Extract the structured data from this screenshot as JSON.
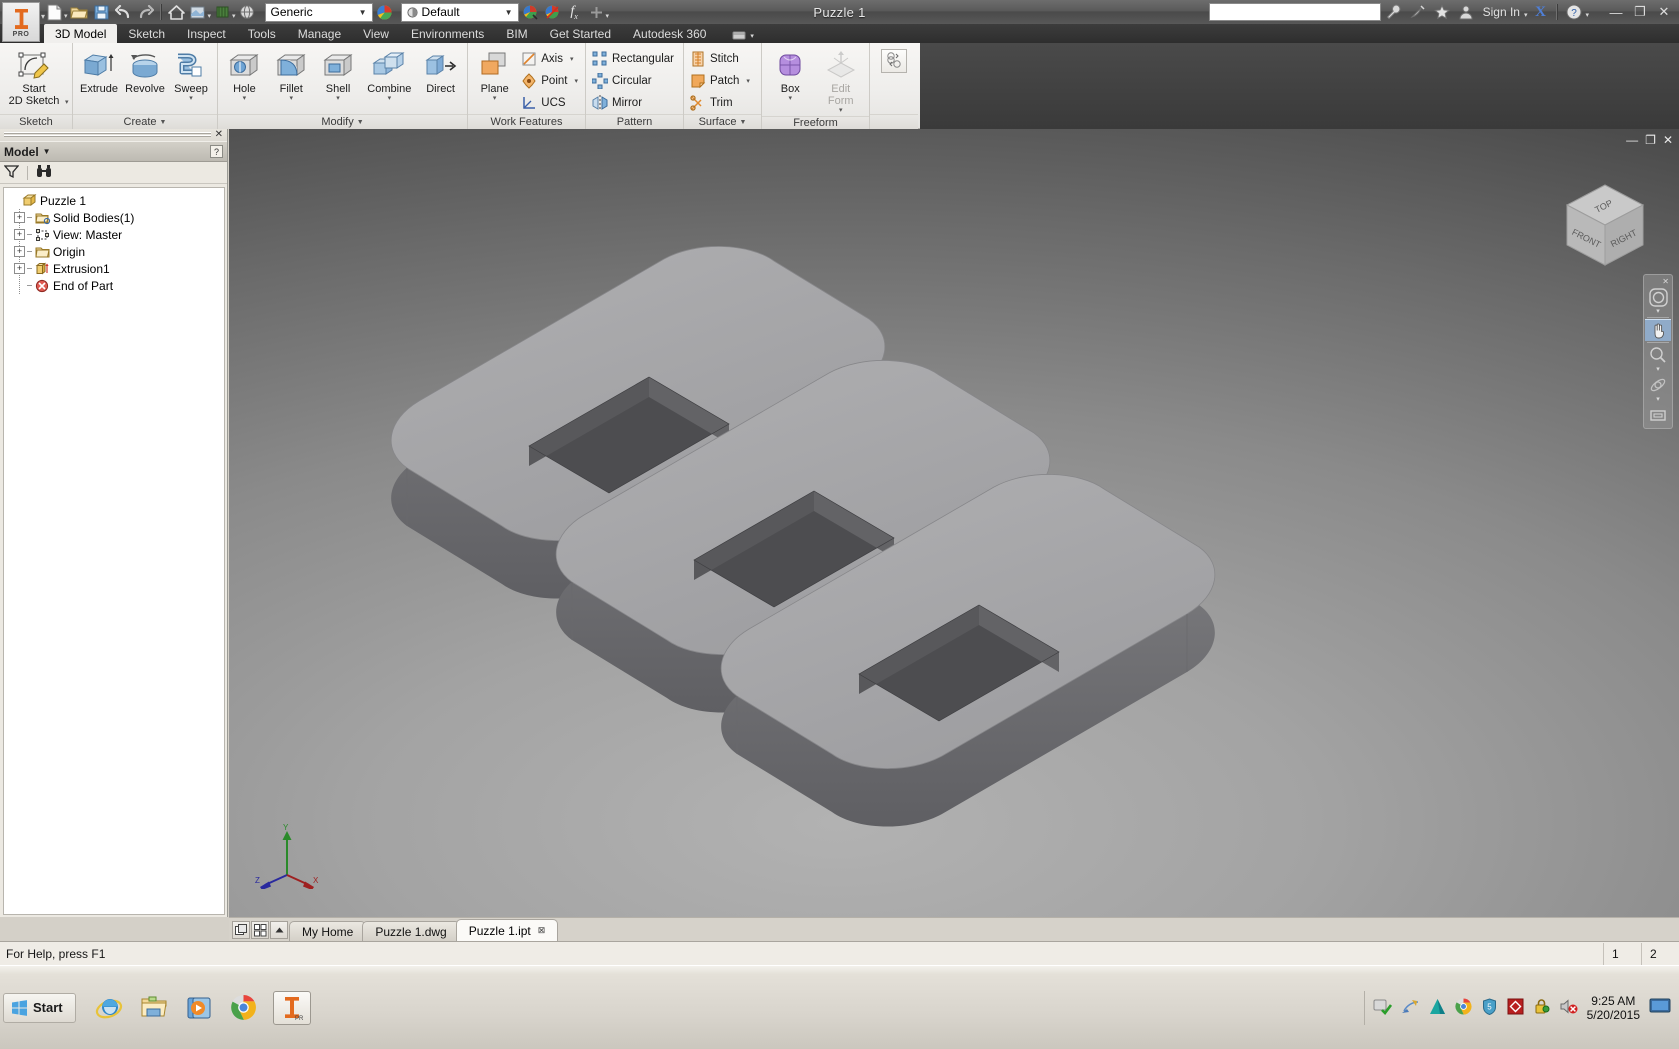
{
  "titlebar": {
    "document_title": "Puzzle 1",
    "material_combo": "Generic",
    "appearance_combo": "Default",
    "search_placeholder": "",
    "search_value": "",
    "signin_label": "Sign In",
    "qat": [
      {
        "name": "new-file",
        "icon": "new-document-icon"
      },
      {
        "name": "open-file",
        "icon": "open-folder-icon"
      },
      {
        "name": "save-file",
        "icon": "save-disk-icon"
      },
      {
        "name": "undo",
        "icon": "undo-arrow-icon"
      },
      {
        "name": "redo",
        "icon": "redo-arrow-icon"
      },
      {
        "name": "home-view",
        "icon": "home-icon"
      },
      {
        "name": "display-style",
        "icon": "shaded-display-icon"
      },
      {
        "name": "appearance-override",
        "icon": "appearance-icon"
      },
      {
        "name": "orbit-view",
        "icon": "orbit-globe-icon"
      }
    ],
    "right_icons": [
      {
        "name": "search-help",
        "icon": "wrench-icon"
      },
      {
        "name": "satellite",
        "icon": "satellite-dish-icon"
      },
      {
        "name": "favorites",
        "icon": "star-icon"
      },
      {
        "name": "account",
        "icon": "person-icon"
      }
    ],
    "exchange_label": "X",
    "help_label": "?",
    "window_buttons": {
      "minimize": "—",
      "restore": "❐",
      "close": "✕"
    }
  },
  "app_button": {
    "label": "PRO"
  },
  "ribbon_tabs": [
    {
      "label": "3D Model",
      "active": true
    },
    {
      "label": "Sketch",
      "active": false
    },
    {
      "label": "Inspect",
      "active": false
    },
    {
      "label": "Tools",
      "active": false
    },
    {
      "label": "Manage",
      "active": false
    },
    {
      "label": "View",
      "active": false
    },
    {
      "label": "Environments",
      "active": false
    },
    {
      "label": "BIM",
      "active": false
    },
    {
      "label": "Get Started",
      "active": false
    },
    {
      "label": "Autodesk 360",
      "active": false
    }
  ],
  "ribbon_panels": [
    {
      "name": "sketch",
      "label": "Sketch",
      "buttons": [
        {
          "label": "Start",
          "label2": "2D Sketch",
          "icon": "start-2d-sketch-icon",
          "dropdown": true
        }
      ]
    },
    {
      "name": "create",
      "label": "Create",
      "has_dialog_launcher": true,
      "buttons": [
        {
          "label": "Extrude",
          "icon": "extrude-icon",
          "dropdown": false
        },
        {
          "label": "Revolve",
          "icon": "revolve-icon",
          "dropdown": false
        },
        {
          "label": "Sweep",
          "icon": "sweep-icon",
          "dropdown": true
        }
      ]
    },
    {
      "name": "modify",
      "label": "Modify",
      "has_dialog_launcher": true,
      "buttons": [
        {
          "label": "Hole",
          "icon": "hole-icon",
          "dropdown": true
        },
        {
          "label": "Fillet",
          "icon": "fillet-icon",
          "dropdown": true
        },
        {
          "label": "Shell",
          "icon": "shell-icon",
          "dropdown": true
        },
        {
          "label": "Combine",
          "icon": "combine-icon",
          "dropdown": true
        },
        {
          "label": "Direct",
          "icon": "direct-edit-icon",
          "dropdown": false
        }
      ]
    },
    {
      "name": "work-features",
      "label": "Work Features",
      "big_buttons": [
        {
          "label": "Plane",
          "icon": "work-plane-icon",
          "dropdown": true
        }
      ],
      "small_buttons": [
        {
          "label": "Axis",
          "icon": "work-axis-icon",
          "dropdown": true
        },
        {
          "label": "Point",
          "icon": "work-point-icon",
          "dropdown": true
        },
        {
          "label": "UCS",
          "icon": "ucs-icon",
          "dropdown": false
        }
      ]
    },
    {
      "name": "pattern",
      "label": "Pattern",
      "small_buttons": [
        {
          "label": "Rectangular",
          "icon": "rectangular-pattern-icon",
          "dropdown": false
        },
        {
          "label": "Circular",
          "icon": "circular-pattern-icon",
          "dropdown": false
        },
        {
          "label": "Mirror",
          "icon": "mirror-icon",
          "dropdown": false
        }
      ]
    },
    {
      "name": "surface",
      "label": "Surface",
      "has_dialog_launcher": true,
      "small_buttons": [
        {
          "label": "Stitch",
          "icon": "stitch-icon",
          "dropdown": false
        },
        {
          "label": "Patch",
          "icon": "patch-icon",
          "dropdown": true
        },
        {
          "label": "Trim",
          "icon": "trim-scissors-icon",
          "dropdown": false
        }
      ]
    },
    {
      "name": "freeform",
      "label": "Freeform",
      "buttons": [
        {
          "label": "Box",
          "icon": "freeform-box-icon",
          "dropdown": true,
          "disabled": false
        },
        {
          "label": "Edit",
          "label2": "Form",
          "icon": "edit-form-icon",
          "dropdown": true,
          "disabled": true
        }
      ]
    },
    {
      "name": "convert",
      "label": "",
      "buttons": [
        {
          "label": "",
          "icon": "convert-icon",
          "dropdown": false
        }
      ]
    }
  ],
  "browser": {
    "panel_title": "Model",
    "help_glyph": "?",
    "tools": [
      {
        "name": "filter-icon",
        "glyph": "filter"
      },
      {
        "name": "find-binoculars-icon",
        "glyph": "binoculars"
      }
    ],
    "tree": [
      {
        "label": "Puzzle 1",
        "icon": "part-document-icon",
        "level": 0,
        "expander": ""
      },
      {
        "label": "Solid Bodies(1)",
        "icon": "solid-bodies-folder-icon",
        "level": 1,
        "expander": "+"
      },
      {
        "label": "View: Master",
        "icon": "view-master-icon",
        "level": 1,
        "expander": "+"
      },
      {
        "label": "Origin",
        "icon": "origin-folder-icon",
        "level": 1,
        "expander": "+"
      },
      {
        "label": "Extrusion1",
        "icon": "extrusion-feature-icon",
        "level": 1,
        "expander": "+"
      },
      {
        "label": "End of Part",
        "icon": "end-of-part-icon",
        "level": 1,
        "expander": ""
      }
    ]
  },
  "viewport": {
    "window_buttons": {
      "minimize": "—",
      "restore": "❐",
      "close": "✕"
    },
    "viewcube": {
      "top_face": "TOP",
      "front_face": "FRONT",
      "right_face": "RIGHT"
    },
    "navbar": {
      "close_glyph": "✕",
      "items": [
        {
          "name": "steering-wheel-icon",
          "selected": false,
          "caret": true
        },
        {
          "name": "pan-hand-icon",
          "selected": true,
          "caret": false
        },
        {
          "name": "zoom-magnifier-icon",
          "selected": false,
          "caret": true
        },
        {
          "name": "orbit-icon",
          "selected": false,
          "caret": true
        },
        {
          "name": "look-at-icon",
          "selected": false,
          "caret": false
        }
      ]
    },
    "axis_triad": {
      "x_label": "X",
      "y_label": "Y",
      "z_label": "Z"
    },
    "model": {
      "name": "three-linked-puzzle-slabs",
      "part_color": "#a6a6a8",
      "side_color": "#6f6f72",
      "cut_color": "#4e4e51"
    }
  },
  "doctabs": {
    "buttons": [
      {
        "name": "cascade-windows-icon"
      },
      {
        "name": "tile-windows-icon"
      },
      {
        "name": "scroll-up-icon"
      }
    ],
    "tabs": [
      {
        "label": "My Home",
        "active": false,
        "closable": false
      },
      {
        "label": "Puzzle 1.dwg",
        "active": false,
        "closable": false
      },
      {
        "label": "Puzzle 1.ipt",
        "active": true,
        "closable": true
      }
    ]
  },
  "statusbar": {
    "message": "For Help, press F1",
    "cells": [
      "1",
      "2"
    ]
  },
  "taskbar": {
    "start_label": "Start",
    "quick_launch": [
      {
        "name": "internet-explorer-icon"
      },
      {
        "name": "file-explorer-icon"
      },
      {
        "name": "media-player-icon"
      },
      {
        "name": "google-chrome-icon"
      }
    ],
    "open_apps": [
      {
        "name": "inventor-app-icon",
        "label": "PRO",
        "active": true
      }
    ],
    "tray_icons": [
      {
        "name": "action-center-icon"
      },
      {
        "name": "network-icon"
      },
      {
        "name": "autodesk-tray-icon"
      },
      {
        "name": "chrome-tray-icon"
      },
      {
        "name": "shield-security-icon"
      },
      {
        "name": "red-diamond-icon"
      },
      {
        "name": "lock-key-icon"
      },
      {
        "name": "volume-muted-icon"
      }
    ],
    "clock_time": "9:25 AM",
    "clock_date": "5/20/2015"
  }
}
